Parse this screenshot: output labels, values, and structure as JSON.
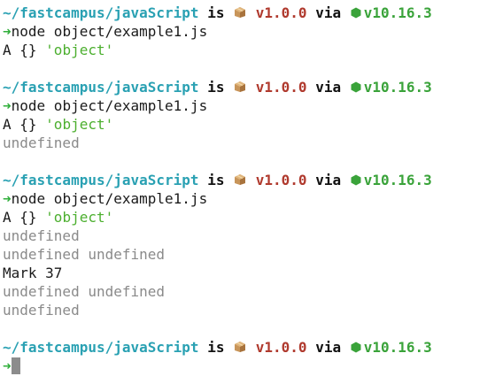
{
  "prompt": {
    "path": "~/fastcampus/javaScript",
    "is": "is",
    "package_icon": "package-icon",
    "version": "v1.0.0",
    "via": "via",
    "node_icon": "nodejs-hex-icon",
    "node_version": "v10.16.3",
    "arrow": "➜"
  },
  "blocks": [
    {
      "command": "node object/example1.js",
      "output": [
        {
          "parts": [
            {
              "text": "A {} ",
              "style": "plain"
            },
            {
              "text": "'object'",
              "style": "string"
            }
          ]
        }
      ]
    },
    {
      "command": "node object/example1.js",
      "output": [
        {
          "parts": [
            {
              "text": "A {} ",
              "style": "plain"
            },
            {
              "text": "'object'",
              "style": "string"
            }
          ]
        },
        {
          "parts": [
            {
              "text": "undefined",
              "style": "dim"
            }
          ]
        }
      ]
    },
    {
      "command": "node object/example1.js",
      "output": [
        {
          "parts": [
            {
              "text": "A {} ",
              "style": "plain"
            },
            {
              "text": "'object'",
              "style": "string"
            }
          ]
        },
        {
          "parts": [
            {
              "text": "undefined",
              "style": "dim"
            }
          ]
        },
        {
          "parts": [
            {
              "text": "undefined undefined",
              "style": "dim"
            }
          ]
        },
        {
          "parts": [
            {
              "text": "Mark 37",
              "style": "plain"
            }
          ]
        },
        {
          "parts": [
            {
              "text": "undefined undefined",
              "style": "dim"
            }
          ]
        },
        {
          "parts": [
            {
              "text": "undefined",
              "style": "dim"
            }
          ]
        }
      ]
    }
  ],
  "colors": {
    "path": "#2aa1b3",
    "version": "#b03a2e",
    "node": "#3aa33a",
    "arrow": "#2fae3a",
    "string": "#4caf2f",
    "dim": "#8a8a8a",
    "cursor": "#8c8c8c"
  }
}
